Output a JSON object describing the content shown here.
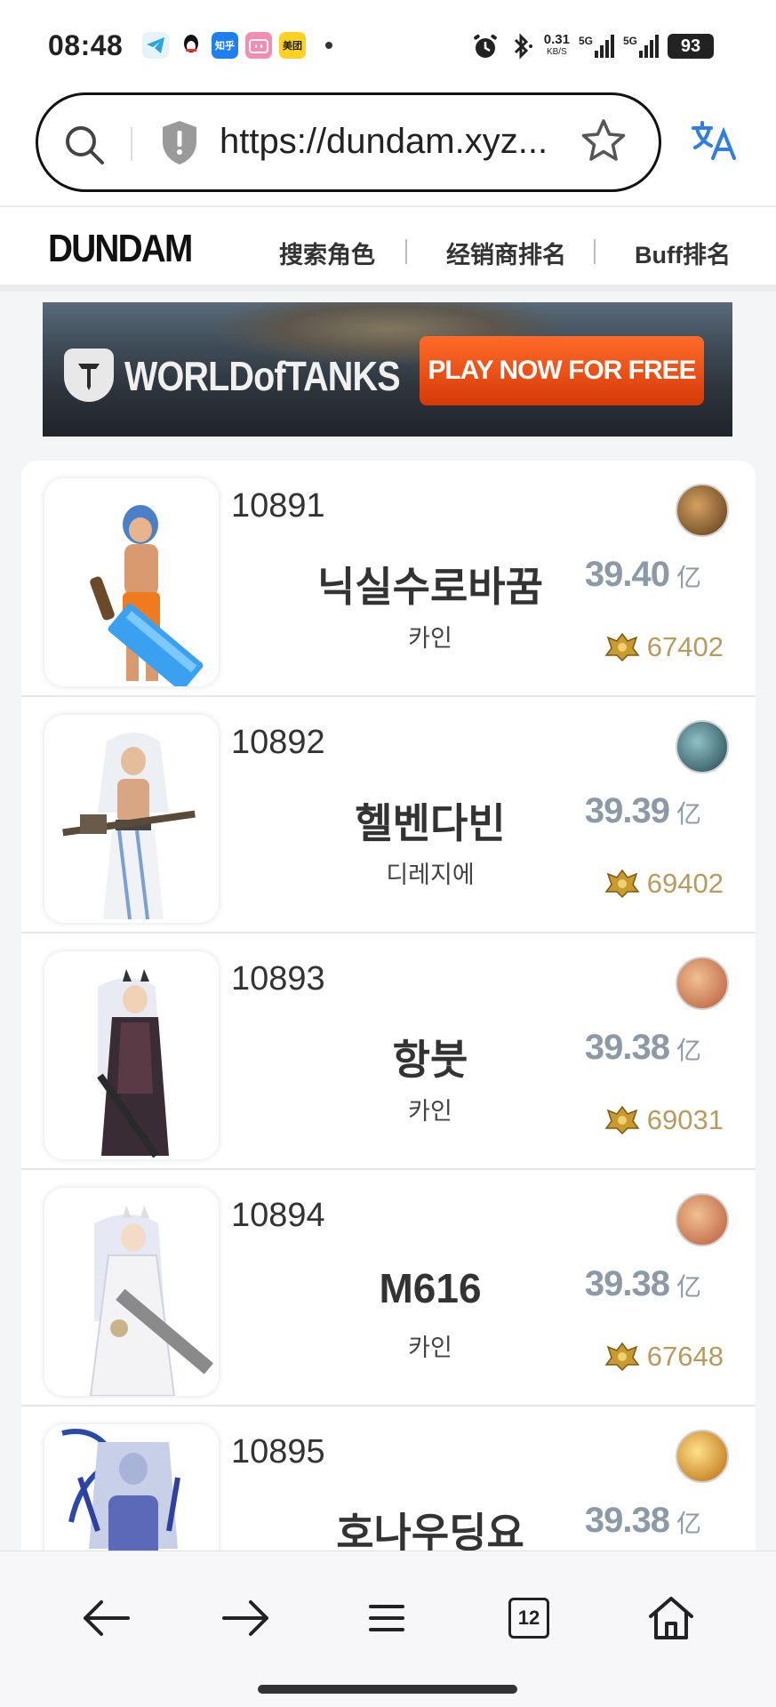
{
  "status_bar": {
    "time": "08:48",
    "notification_icons": [
      "telegram-icon",
      "qq-icon",
      "zhihu-icon",
      "bilibili-icon",
      "meituan-icon"
    ],
    "zhihu_label": "知乎",
    "meituan_label": "美团",
    "net_speed_value": "0.31",
    "net_speed_unit": "KB/S",
    "signal_1": "5G",
    "signal_2": "5G",
    "battery": "93"
  },
  "browser": {
    "url": "https://dundam.xyz..."
  },
  "site_nav": {
    "logo": "DUNDAM",
    "links": [
      "搜索角色",
      "经销商排名",
      "Buff排名"
    ]
  },
  "banner": {
    "title": "WORLDofTANKS",
    "cta": "PLAY NOW FOR FREE"
  },
  "characters": [
    {
      "rank": "10891",
      "name": "닉실수로바꿈",
      "job": "카인",
      "score": "39.40",
      "unit": "亿",
      "fame": "67402",
      "class_icon": "sword-class-icon",
      "icon_color": "#8a5a24"
    },
    {
      "rank": "10892",
      "name": "헬벤다빈",
      "job": "디레지에",
      "score": "39.39",
      "unit": "亿",
      "fame": "69402",
      "class_icon": "spear-class-icon",
      "icon_color": "#3d6f7c"
    },
    {
      "rank": "10893",
      "name": "항붓",
      "job": "카인",
      "score": "39.38",
      "unit": "亿",
      "fame": "69031",
      "class_icon": "blade-class-icon",
      "icon_color": "#d28a52"
    },
    {
      "rank": "10894",
      "name": "M616",
      "job": "카인",
      "score": "39.38",
      "unit": "亿",
      "fame": "67648",
      "class_icon": "blade-class-icon",
      "icon_color": "#d28a52"
    },
    {
      "rank": "10895",
      "name": "호나우딩요",
      "job": "",
      "score": "39.38",
      "unit": "亿",
      "fame": "",
      "class_icon": "flame-sword-class-icon",
      "icon_color": "#e0a020"
    }
  ],
  "bottom_bar": {
    "tab_count": "12"
  }
}
